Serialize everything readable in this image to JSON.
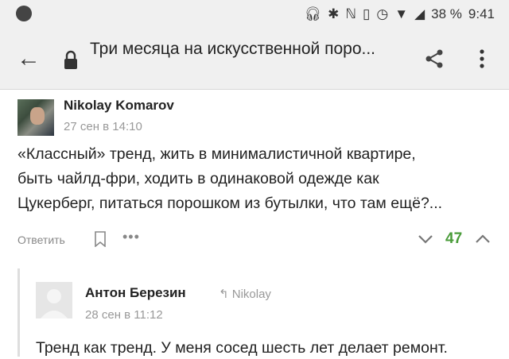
{
  "status_bar": {
    "battery": "38 %",
    "time": "9:41"
  },
  "toolbar": {
    "title": "Три месяца на искусственной поро..."
  },
  "comment": {
    "author": "Nikolay Komarov",
    "date": "27 сен в 14:10",
    "text_lines": [
      "«Классный» тренд, жить в минималистичной квартире,",
      "быть чайлд-фри, ходить в одинаковой одежде как",
      "Цукерберг, питаться порошком из бутылки, что там ещё?..."
    ],
    "reply_label": "Ответить",
    "more_label": "•••",
    "votes": "47",
    "vote_color": "#4a9c3a"
  },
  "reply": {
    "author": "Антон Березин",
    "reply_to": "Nikolay",
    "date": "28 сен в 11:12",
    "text": "Тренд как тренд. У меня сосед шесть лет делает ремонт."
  }
}
